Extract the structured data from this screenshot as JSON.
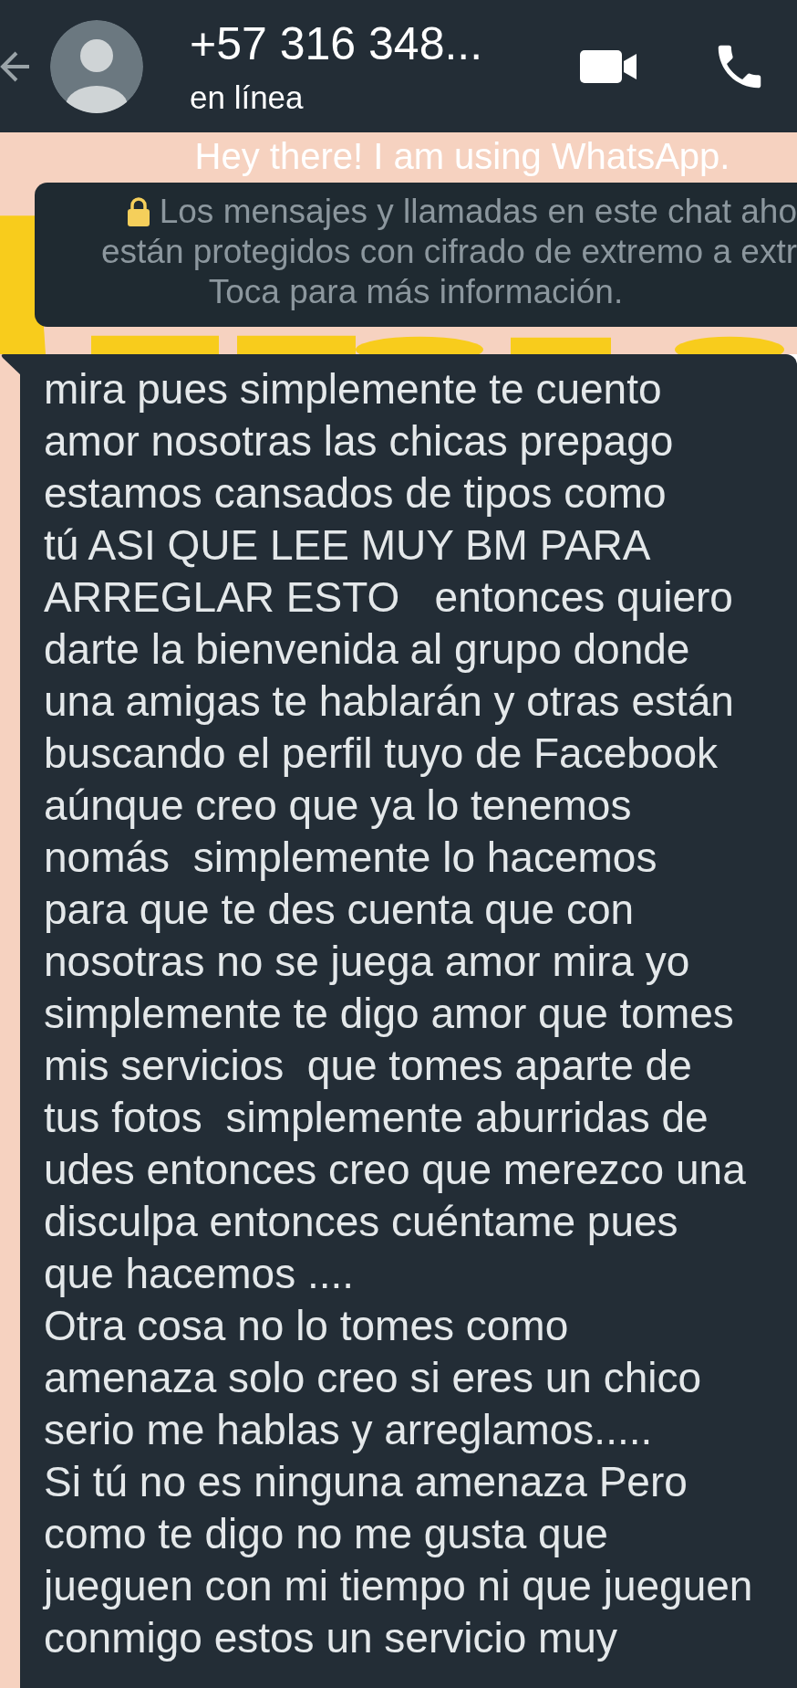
{
  "header": {
    "title": "+57 316 348...",
    "status": "en línea"
  },
  "about": "Hey there! I am using WhatsApp.",
  "encryption_notice": {
    "lines": [
      "Los mensajes y llamadas en este chat aho",
      "están protegidos con cifrado de extremo a extr",
      "Toca para más información."
    ]
  },
  "messages": [
    {
      "text": "mira pues simplemente te cuento\namor nosotras las chicas prepago\nestamos cansados de tipos como\ntú ASI QUE LEE MUY BM PARA\nARREGLAR ESTO   entonces quiero\ndarte la bienvenida al grupo donde\nuna amigas te hablarán y otras están\nbuscando el perfil tuyo de Facebook\naúnque creo que ya lo tenemos\nnomás  simplemente lo hacemos\npara que te des cuenta que con\nnosotras no se juega amor mira yo\nsimplemente te digo amor que tomes\nmis servicios  que tomes aparte de\ntus fotos  simplemente aburridas de\nudes entonces creo que merezco una\ndisculpa entonces cuéntame pues\nque hacemos ....\nOtra cosa no lo tomes como\namenaza solo creo si eres un chico\nserio me hablas y arreglamos.....\nSi tú no es ninguna amenaza Pero\ncomo te digo no me gusta que\njueguen con mi tiempo ni que jueguen\nconmigo estos un servicio muy"
    }
  ]
}
